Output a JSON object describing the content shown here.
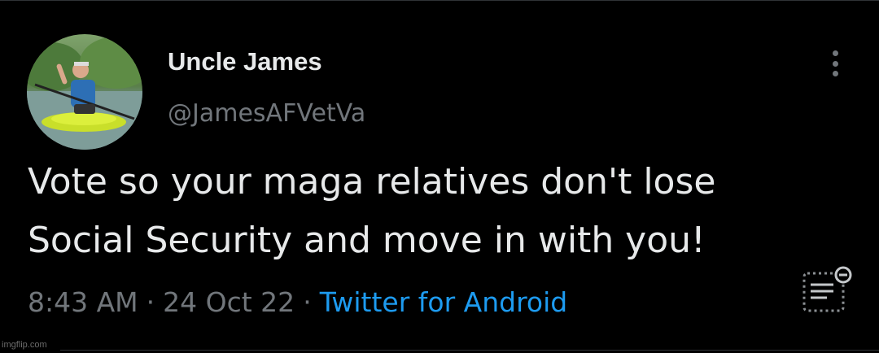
{
  "tweet": {
    "author": {
      "display_name": "Uncle James",
      "handle": "@JamesAFVetVa"
    },
    "text_line1": "Vote so your maga relatives don't lose",
    "text_line2": "Social Security and move in with you!",
    "meta": {
      "time": "8:43 AM",
      "separator": "·",
      "date": "24 Oct 22",
      "source": "Twitter for Android"
    }
  },
  "icons": {
    "more": "more-vertical-icon",
    "avatar": "avatar-photo",
    "summary": "document-lines-icon"
  },
  "watermark": "imgflip.com",
  "colors": {
    "background": "#000000",
    "text_primary": "#e7e9ea",
    "text_secondary": "#71767b",
    "link": "#1d9bf0",
    "divider": "#2f3336"
  }
}
